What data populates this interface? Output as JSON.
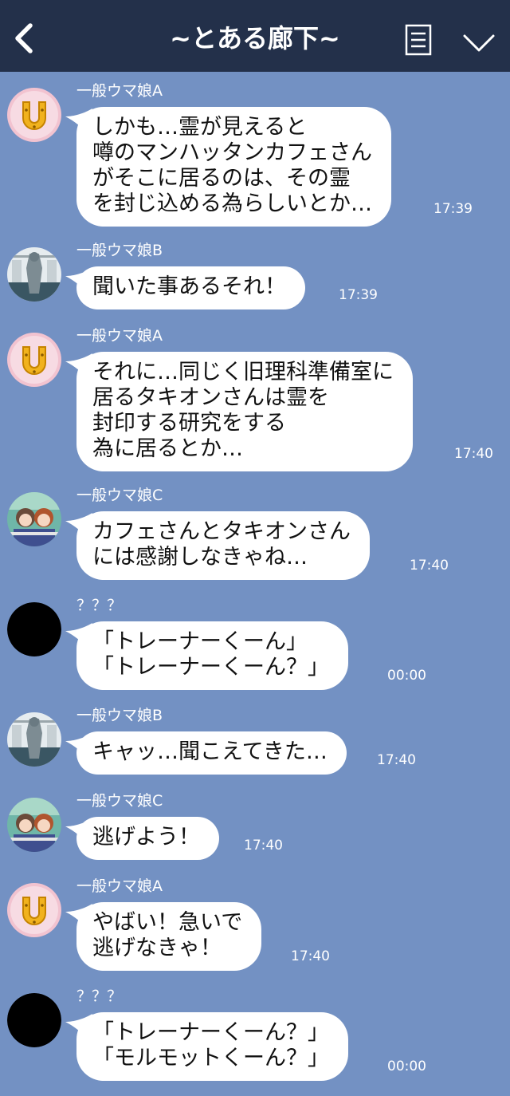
{
  "header": {
    "title": "~とある廊下~",
    "back_icon": "chevron-left-icon",
    "menu_icon": "note-list-icon",
    "collapse_icon": "chevron-down-icon",
    "background": "#23304a"
  },
  "chat": {
    "background": "#7391c3",
    "bubble_color": "#ffffff",
    "messages": [
      {
        "sender": "一般ウマ娘A",
        "avatar": "horseshoe-avatar",
        "text": "しかも…霊が見えると\n噂のマンハッタンカフェさん\nがそこに居るのは、その霊\nを封じ込める為らしいとか…",
        "time": "17:39"
      },
      {
        "sender": "一般ウマ娘B",
        "avatar": "statue-avatar",
        "text": "聞いた事あるそれ！",
        "time": "17:39"
      },
      {
        "sender": "一般ウマ娘A",
        "avatar": "horseshoe-avatar",
        "text": "それに…同じく旧理科準備室に\n居るタキオンさんは霊を\n封印する研究をする\n為に居るとか…",
        "time": "17:40"
      },
      {
        "sender": "一般ウマ娘C",
        "avatar": "two-girls-avatar",
        "text": "カフェさんとタキオンさん\nには感謝しなきゃね…",
        "time": "17:40"
      },
      {
        "sender": "？？？",
        "avatar": "black-circle-avatar",
        "text": "「トレーナーくーん」\n「トレーナーくーん？」",
        "time": "00:00"
      },
      {
        "sender": "一般ウマ娘B",
        "avatar": "statue-avatar",
        "text": "キャッ…聞こえてきた…",
        "time": "17:40"
      },
      {
        "sender": "一般ウマ娘C",
        "avatar": "two-girls-avatar",
        "text": "逃げよう！",
        "time": "17:40"
      },
      {
        "sender": "一般ウマ娘A",
        "avatar": "horseshoe-avatar",
        "text": "やばい！急いで\n逃げなきゃ！",
        "time": "17:40"
      },
      {
        "sender": "？？？",
        "avatar": "black-circle-avatar",
        "text": "「トレーナーくーん？」\n「モルモットくーん？」",
        "time": "00:00"
      }
    ]
  }
}
